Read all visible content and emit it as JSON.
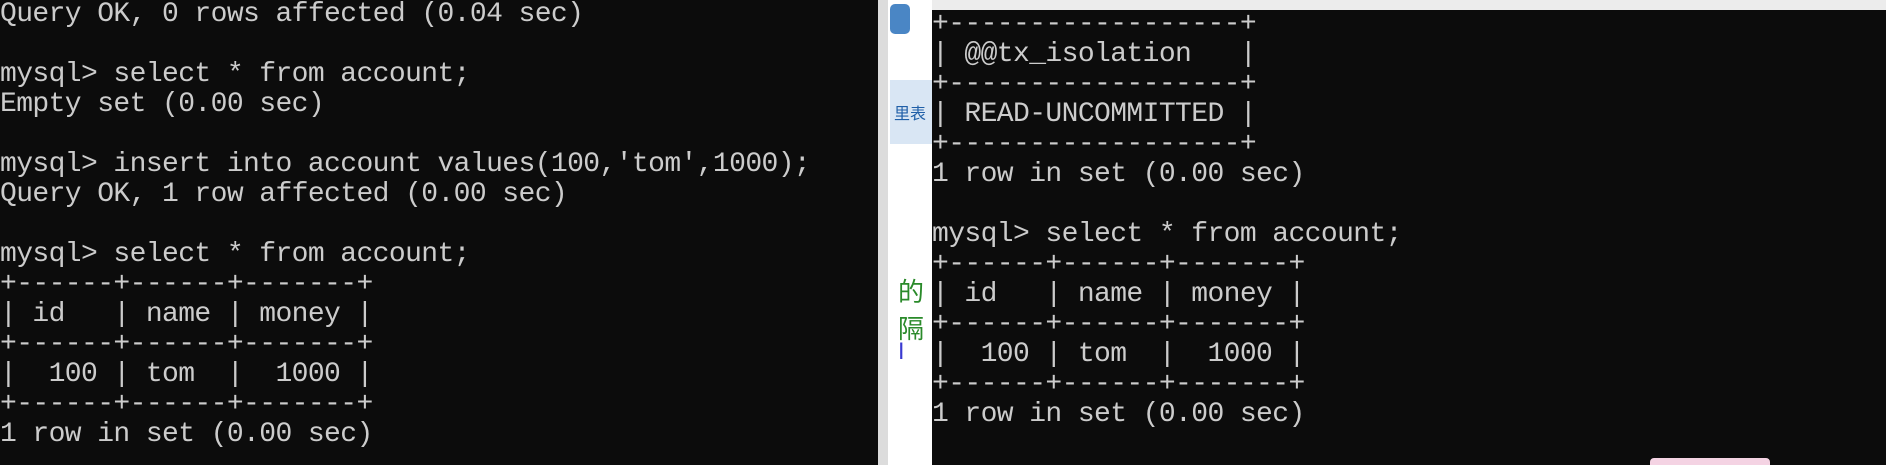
{
  "left_terminal": {
    "lines": [
      "Query OK, 0 rows affected (0.04 sec)",
      "",
      "mysql> select * from account;",
      "Empty set (0.00 sec)",
      "",
      "mysql> insert into account values(100,'tom',1000);",
      "Query OK, 1 row affected (0.00 sec)",
      "",
      "mysql> select * from account;",
      "+------+------+-------+",
      "| id   | name | money |",
      "+------+------+-------+",
      "|  100 | tom  |  1000 |",
      "+------+------+-------+",
      "1 row in set (0.00 sec)"
    ]
  },
  "right_terminal": {
    "lines": [
      "+------------------+",
      "| @@tx_isolation   |",
      "+------------------+",
      "| READ-UNCOMMITTED |",
      "+------------------+",
      "1 row in set (0.00 sec)",
      "",
      "mysql> select * from account;",
      "+------+------+-------+",
      "| id   | name | money |",
      "+------+------+-------+",
      "|  100 | tom  |  1000 |",
      "+------+------+-------+",
      "1 row in set (0.00 sec)"
    ]
  },
  "background_window": {
    "label_fragment": "里表",
    "char_fragment": "的隔",
    "char_fragment2": "I"
  }
}
